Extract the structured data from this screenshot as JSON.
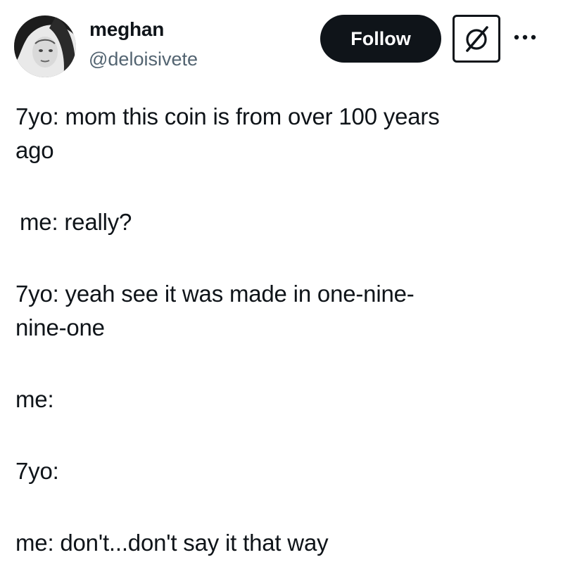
{
  "author": {
    "display_name": "meghan",
    "handle": "@deloisivete",
    "avatar_icon": "profile-photo-icon"
  },
  "actions": {
    "follow_label": "Follow",
    "grok_icon": "grok-icon",
    "more_icon": "more-dots-icon"
  },
  "tweet": {
    "lines": [
      "7yo: mom this coin is from over 100 years",
      "ago",
      "me: really?",
      "7yo: yeah see it was made in one-nine-",
      "nine-one",
      "me:",
      "7yo:",
      "me: don't...don't say it that way"
    ]
  },
  "colors": {
    "text": "#0f1419",
    "secondary": "#536471",
    "button_bg": "#0f1419",
    "button_text": "#ffffff",
    "background": "#ffffff"
  }
}
